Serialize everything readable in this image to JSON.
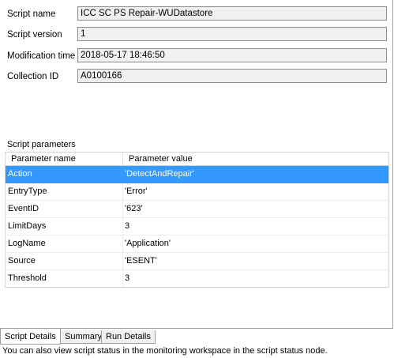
{
  "details": {
    "fields": [
      {
        "label": "Script name",
        "value": "ICC SC PS Repair-WUDatastore"
      },
      {
        "label": "Script version",
        "value": "1"
      },
      {
        "label": "Modification time",
        "value": "2018-05-17 18:46:50"
      },
      {
        "label": "Collection ID",
        "value": "A0100166"
      }
    ]
  },
  "parameters": {
    "title": "Script parameters",
    "columns": [
      "Parameter name",
      "Parameter value"
    ],
    "rows": [
      {
        "name": "Action",
        "value": "'DetectAndRepair'"
      },
      {
        "name": "EntryType",
        "value": "'Error'"
      },
      {
        "name": "EventID",
        "value": "'623'"
      },
      {
        "name": "LimitDays",
        "value": "3"
      },
      {
        "name": "LogName",
        "value": "'Application'"
      },
      {
        "name": "Source",
        "value": "'ESENT'"
      },
      {
        "name": "Threshold",
        "value": "3"
      }
    ]
  },
  "tabs": [
    {
      "label": "Script Details",
      "active": true
    },
    {
      "label": "Summary",
      "active": false
    },
    {
      "label": "Run Details",
      "active": false
    }
  ],
  "status_text": "You can also view script status in the monitoring workspace in the script status node.",
  "colors": {
    "selection": "#3399ff",
    "field_bg": "#f0f0f0"
  }
}
